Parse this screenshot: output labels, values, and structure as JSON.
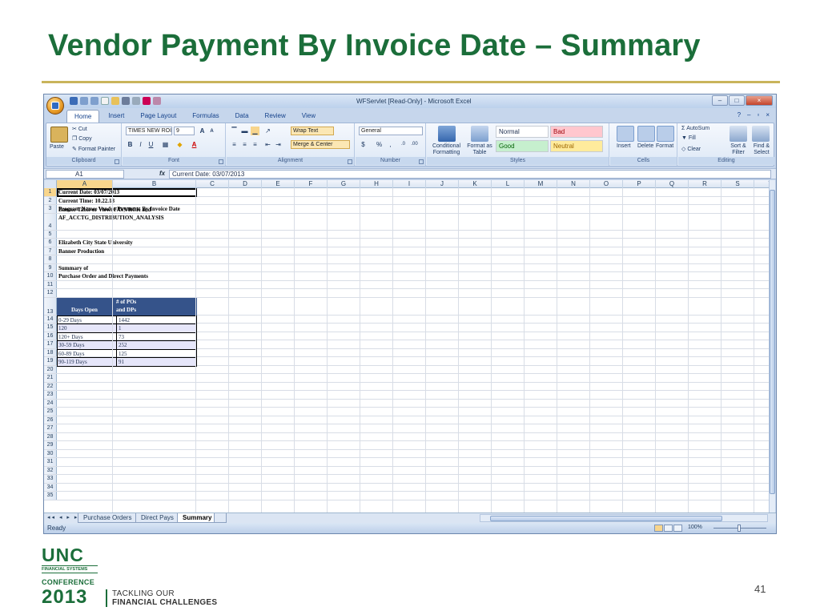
{
  "slide": {
    "title": "Vendor Payment By Invoice Date – Summary",
    "page_number": "41",
    "logo": {
      "unc": "UNC",
      "financial_systems": "FINANCIAL SYSTEMS",
      "conference": "CONFERENCE",
      "year": "2013",
      "tagline1": "TACKLING OUR",
      "tagline2": "FINANCIAL CHALLENGES"
    }
  },
  "excel": {
    "window_title": "WFServlet  [Read-Only] - Microsoft Excel",
    "tabs": [
      "Home",
      "Insert",
      "Page Layout",
      "Formulas",
      "Data",
      "Review",
      "View"
    ],
    "active_tab": "Home",
    "ribbon": {
      "clipboard": {
        "label": "Clipboard",
        "paste": "Paste",
        "cut": "Cut",
        "copy": "Copy",
        "format_painter": "Format Painter"
      },
      "font": {
        "label": "Font",
        "name": "TIMES NEW ROI",
        "size": "9",
        "bold": "B",
        "italic": "I",
        "underline": "U"
      },
      "alignment": {
        "label": "Alignment",
        "wrap_text": "Wrap Text",
        "merge": "Merge & Center"
      },
      "number": {
        "label": "Number",
        "format": "General",
        "currency": "$",
        "percent": "%",
        "comma": ","
      },
      "styles": {
        "label": "Styles",
        "conditional": "Conditional Formatting",
        "format_table": "Format as Table",
        "normal": "Normal",
        "bad": "Bad",
        "good": "Good",
        "neutral": "Neutral"
      },
      "cells": {
        "label": "Cells",
        "insert": "Insert",
        "delete": "Delete",
        "format": "Format"
      },
      "editing": {
        "label": "Editing",
        "autosum": "AutoSum",
        "fill": "Fill",
        "clear": "Clear",
        "sort": "Sort & Filter",
        "find": "Find & Select"
      }
    },
    "name_box": "A1",
    "formula": "Current Date: 03/07/2013",
    "columns": [
      "A",
      "B",
      "C",
      "D",
      "E",
      "F",
      "G",
      "H",
      "I",
      "J",
      "K",
      "L",
      "M",
      "N",
      "O",
      "P",
      "Q",
      "R",
      "S",
      "T"
    ],
    "rows": [
      {
        "n": "1",
        "text": "Current Date: 03/07/2013"
      },
      {
        "n": "2",
        "text": "Current Time: 10.22.18"
      },
      {
        "n": "3",
        "text": "Program Name: Vendor Payments By Invoice Date"
      },
      {
        "n": "4",
        "text": "AF_ACCTG_DISTRIBUTION_ANALYSIS",
        "text_above": "Banner Table or View: FAVVRCK and"
      },
      {
        "n": "5",
        "text": ""
      },
      {
        "n": "6",
        "text": "Elizabeth City State University"
      },
      {
        "n": "7",
        "text": "Banner Production"
      },
      {
        "n": "8",
        "text": ""
      },
      {
        "n": "9",
        "text": "Summary of"
      },
      {
        "n": "10",
        "text": "Purchase Order and Direct Payments"
      },
      {
        "n": "11",
        "text": ""
      },
      {
        "n": "12",
        "text": ""
      }
    ],
    "table": {
      "row_numbers": [
        "13",
        "14",
        "15",
        "16",
        "17",
        "18",
        "19"
      ],
      "headers": [
        "Days Open",
        "# of POs",
        "and DPs"
      ],
      "data": [
        [
          "0-29 Days",
          "1442"
        ],
        [
          "120",
          "1"
        ],
        [
          "120+ Days",
          "73"
        ],
        [
          "30-59 Days",
          "252"
        ],
        [
          "60-89 Days",
          "125"
        ],
        [
          "90-119 Days",
          "91"
        ]
      ]
    },
    "empty_rows": [
      "20",
      "21",
      "22",
      "23",
      "24",
      "25",
      "26",
      "27",
      "28",
      "29",
      "30",
      "31",
      "32",
      "33",
      "34",
      "35"
    ],
    "sheets": [
      "Purchase Orders",
      "Direct Pays",
      "Summary"
    ],
    "active_sheet": "Summary",
    "status": "Ready",
    "zoom": "100%"
  }
}
